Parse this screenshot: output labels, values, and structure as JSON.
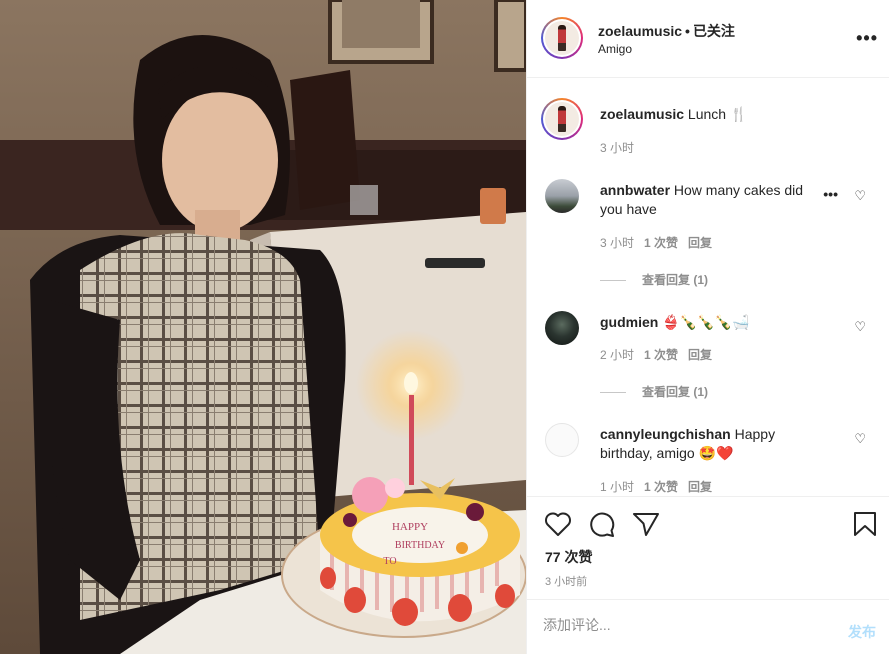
{
  "header": {
    "username": "zoelaumusic",
    "separator": "•",
    "follow_status": "已关注",
    "location": "Amigo",
    "more_icon": "more-horizontal-icon"
  },
  "caption": {
    "username": "zoelaumusic",
    "text": "Lunch 🍴",
    "time": "3 小时"
  },
  "comments": [
    {
      "username": "annbwater",
      "text": "How many cakes did you have",
      "time": "3 小时",
      "likes": "1 次赞",
      "reply": "回复",
      "view_replies": "查看回复 (1)"
    },
    {
      "username": "gudmien",
      "text": "👙🍾🍾🍾🛁",
      "time": "2 小时",
      "likes": "1 次赞",
      "reply": "回复",
      "view_replies": "查看回复 (1)"
    },
    {
      "username": "cannyleungchishan",
      "text": "Happy birthday, amigo 🤩❤️",
      "time": "1 小时",
      "likes": "1 次赞",
      "reply": "回复"
    }
  ],
  "actions": {
    "like_count": "77 次赞",
    "timestamp": "3 小时前"
  },
  "add_comment": {
    "placeholder": "添加评论...",
    "post_label": "发布"
  },
  "photo": {
    "cake_text_line1": "HAPPY",
    "cake_text_line2": "BIRTHDAY",
    "cake_text_line3": "TO"
  },
  "colors": {
    "link_blue_disabled": "#b2dffc",
    "secondary_text": "#8e8e8e",
    "border": "#efefef",
    "heart_red": "#ed4956"
  }
}
